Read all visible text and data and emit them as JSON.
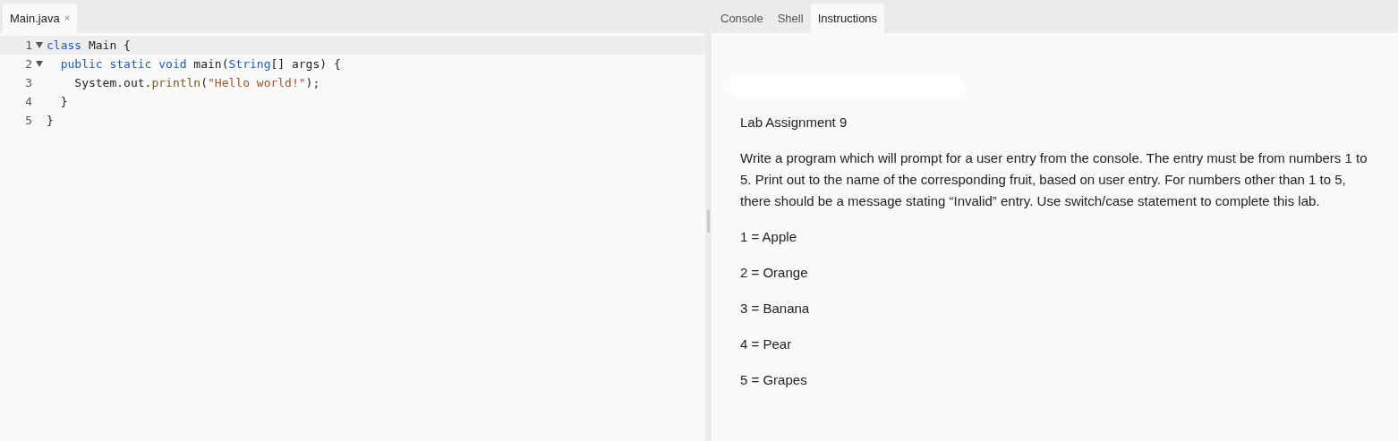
{
  "editor": {
    "tabs": [
      {
        "label": "Main.java",
        "close": "×",
        "selected": true
      }
    ],
    "lines": [
      {
        "number": "1",
        "foldable": true,
        "active": true,
        "tokens": [
          {
            "text": "class",
            "kind": "keyword"
          },
          {
            "text": " Main {",
            "kind": "plain"
          }
        ]
      },
      {
        "number": "2",
        "foldable": true,
        "active": false,
        "tokens": [
          {
            "text": "  public static void",
            "kind": "keyword"
          },
          {
            "text": " main(",
            "kind": "plain"
          },
          {
            "text": "String",
            "kind": "type"
          },
          {
            "text": "[] args) {",
            "kind": "plain"
          }
        ]
      },
      {
        "number": "3",
        "foldable": false,
        "active": false,
        "tokens": [
          {
            "text": "    System.out.",
            "kind": "plain"
          },
          {
            "text": "println",
            "kind": "method"
          },
          {
            "text": "(",
            "kind": "plain"
          },
          {
            "text": "\"Hello world!\"",
            "kind": "string"
          },
          {
            "text": ");",
            "kind": "plain"
          }
        ]
      },
      {
        "number": "4",
        "foldable": false,
        "active": false,
        "tokens": [
          {
            "text": "  }",
            "kind": "plain"
          }
        ]
      },
      {
        "number": "5",
        "foldable": false,
        "active": false,
        "tokens": [
          {
            "text": "}",
            "kind": "plain"
          }
        ]
      }
    ]
  },
  "panel": {
    "tabs": [
      {
        "label": "Console",
        "selected": false
      },
      {
        "label": "Shell",
        "selected": false
      },
      {
        "label": "Instructions",
        "selected": true
      }
    ],
    "title": "Lab Assignment 9",
    "paragraphs": [
      "Write a program which will prompt for a user entry from the console. The entry must be from numbers 1 to 5. Print out to the name of the corresponding fruit, based on user entry. For numbers other than 1 to 5, there should be a message stating “Invalid” entry. Use switch/case statement to complete this lab.",
      "1 = Apple",
      "2 = Orange",
      "3 = Banana",
      "4 = Pear",
      "5 = Grapes"
    ]
  }
}
